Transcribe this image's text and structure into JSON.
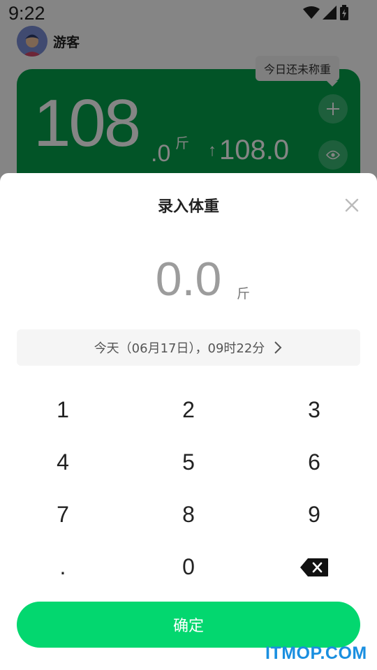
{
  "status_bar": {
    "time": "9:22"
  },
  "profile": {
    "username": "游客"
  },
  "weight_card": {
    "weight_integer": "108",
    "weight_decimal": ".0",
    "unit": "斤",
    "change_arrow": "↑",
    "change_value": "108.0",
    "tooltip": "今日还未称重"
  },
  "sheet": {
    "title": "录入体重",
    "input_value": "0.0",
    "input_unit": "斤",
    "date_text": "今天（06月17日），09时22分",
    "keys": [
      "1",
      "2",
      "3",
      "4",
      "5",
      "6",
      "7",
      "8",
      "9",
      ".",
      "0"
    ],
    "confirm_label": "确定"
  },
  "watermark": "ITMOP.COM",
  "colors": {
    "card_green": "#04a24c",
    "confirm_green": "#03d76f",
    "watermark_blue": "#1a8fe0"
  }
}
